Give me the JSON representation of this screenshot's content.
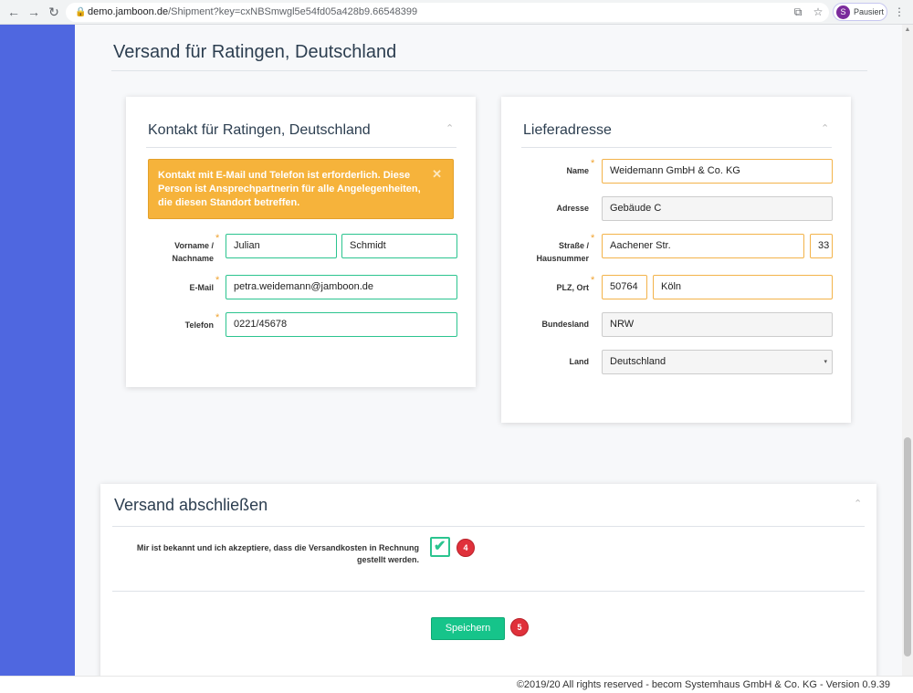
{
  "browser": {
    "back_icon": "←",
    "forward_icon": "→",
    "reload_icon": "↻",
    "lock_icon": "🔒",
    "url_host": "demo.jamboon.de",
    "url_path": "/Shipment?key=cxNBSmwgl5e54fd05a428b9.66548399",
    "translate_icon": "⧉",
    "star_icon": "☆",
    "profile_initial": "S",
    "profile_label": "Pausiert",
    "menu_icon": "⋮"
  },
  "page": {
    "title": "Versand für Ratingen, Deutschland",
    "sidebar_color": "#4f67e0"
  },
  "contact": {
    "title": "Kontakt für Ratingen, Deutschland",
    "collapse_icon": "⌃",
    "alert_text": "Kontakt mit E-Mail und Telefon ist erforderlich. Diese Person ist Ansprechpartnerin für alle Angelegenheiten, die diesen Standort betreffen.",
    "alert_close": "✕",
    "name_label_1": "Vorname /",
    "name_label_2": "Nachname",
    "first_name": "Julian",
    "last_name": "Schmidt",
    "email_label": "E-Mail",
    "email": "petra.weidemann@jamboon.de",
    "phone_label": "Telefon",
    "phone": "0221/45678",
    "required_mark": "*"
  },
  "address": {
    "title": "Lieferadresse",
    "collapse_icon": "⌃",
    "name_label": "Name",
    "name": "Weidemann GmbH & Co. KG",
    "adresse_label": "Adresse",
    "adresse": "Gebäude C",
    "street_label_1": "Straße /",
    "street_label_2": "Hausnummer",
    "street": "Aachener Str.",
    "house_number": "33",
    "plz_label": "PLZ, Ort",
    "plz": "50764",
    "city": "Köln",
    "state_label": "Bundesland",
    "state": "NRW",
    "country_label": "Land",
    "country": "Deutschland",
    "select_caret": "▾",
    "required_mark": "*"
  },
  "finish": {
    "title": "Versand abschließen",
    "collapse_icon": "⌃",
    "consent_text": "Mir ist bekannt und ich akzeptiere, dass die Versandkosten in Rechnung gestellt werden.",
    "consent_checked": true,
    "check_icon": "✔",
    "step_4": "4",
    "save_label": "Speichern",
    "step_5": "5"
  },
  "footer": {
    "text": "©2019/20 All rights reserved - becom Systemhaus GmbH & Co. KG - Version 0.9.39"
  }
}
